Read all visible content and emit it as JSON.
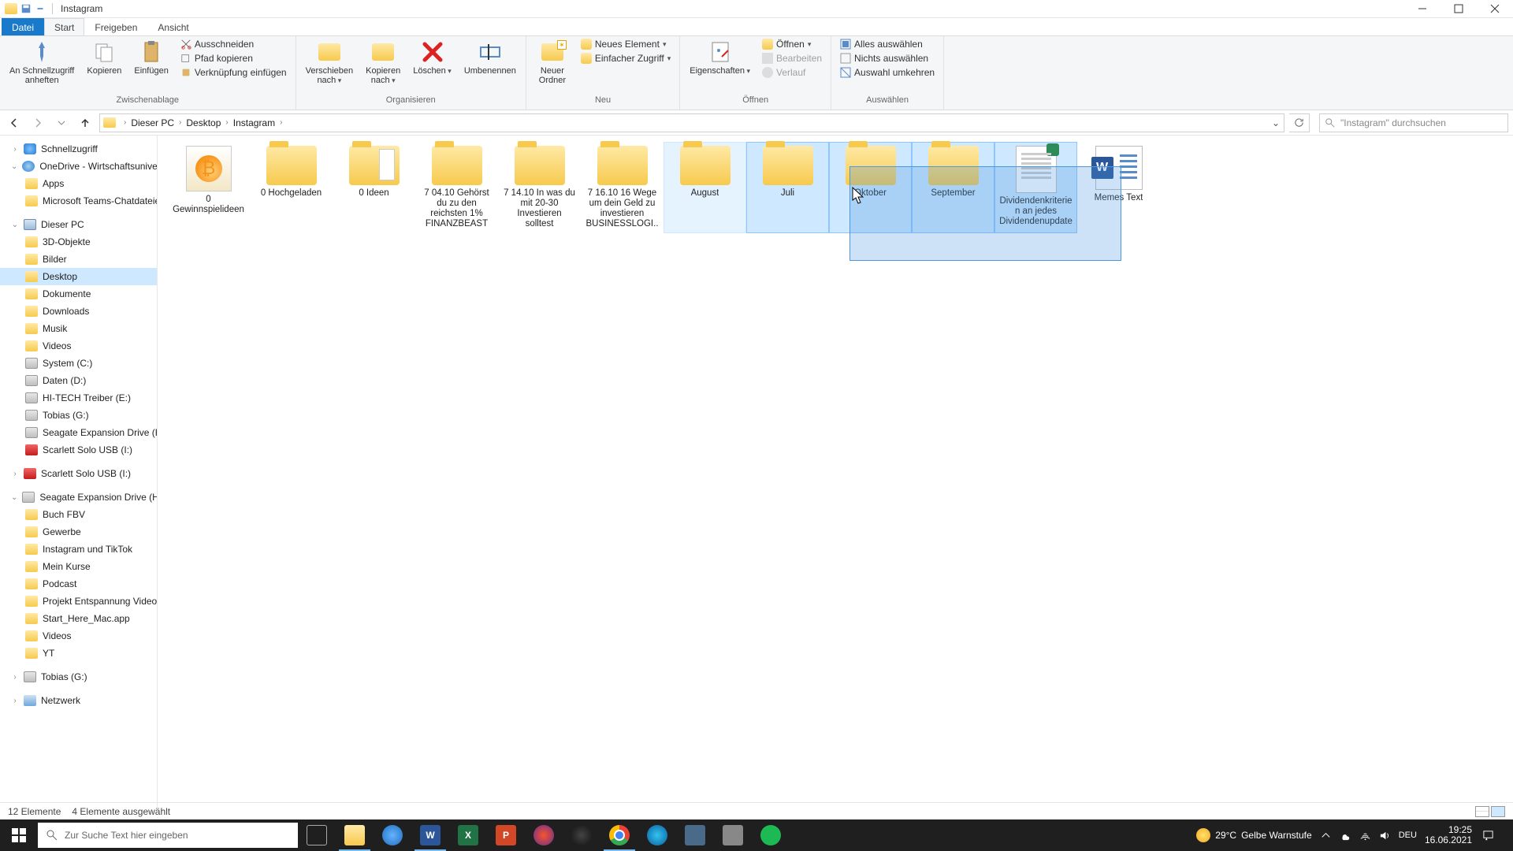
{
  "window": {
    "title": "Instagram"
  },
  "tabs": {
    "file": "Datei",
    "start": "Start",
    "share": "Freigeben",
    "view": "Ansicht"
  },
  "ribbon": {
    "clipboard": {
      "pin": "An Schnellzugriff\nanheften",
      "copy": "Kopieren",
      "paste": "Einfügen",
      "cut": "Ausschneiden",
      "copypath": "Pfad kopieren",
      "pastelnk": "Verknüpfung einfügen",
      "label": "Zwischenablage"
    },
    "organize": {
      "moveto": "Verschieben\nnach",
      "copyto": "Kopieren\nnach",
      "delete": "Löschen",
      "rename": "Umbenennen",
      "label": "Organisieren"
    },
    "new": {
      "newfolder": "Neuer\nOrdner",
      "newitem": "Neues Element",
      "easyaccess": "Einfacher Zugriff",
      "label": "Neu"
    },
    "open": {
      "properties": "Eigenschaften",
      "open": "Öffnen",
      "edit": "Bearbeiten",
      "history": "Verlauf",
      "label": "Öffnen"
    },
    "select": {
      "selectall": "Alles auswählen",
      "selectnone": "Nichts auswählen",
      "invert": "Auswahl umkehren",
      "label": "Auswählen"
    }
  },
  "breadcrumb": [
    "Dieser PC",
    "Desktop",
    "Instagram"
  ],
  "search_placeholder": "\"Instagram\" durchsuchen",
  "tree": [
    {
      "icon": "star",
      "label": "Schnellzugriff",
      "level": 1,
      "exp": "›"
    },
    {
      "icon": "onedrive",
      "label": "OneDrive - Wirtschaftsuniversität",
      "level": 1,
      "exp": "⌄"
    },
    {
      "icon": "folder",
      "label": "Apps",
      "level": 2
    },
    {
      "icon": "folder",
      "label": "Microsoft Teams-Chatdateien",
      "level": 2
    },
    {
      "icon": "pc",
      "label": "Dieser PC",
      "level": 1,
      "exp": "⌄"
    },
    {
      "icon": "folder",
      "label": "3D-Objekte",
      "level": 2
    },
    {
      "icon": "folder",
      "label": "Bilder",
      "level": 2
    },
    {
      "icon": "folder",
      "label": "Desktop",
      "level": 2,
      "sel": true
    },
    {
      "icon": "folder",
      "label": "Dokumente",
      "level": 2
    },
    {
      "icon": "folder",
      "label": "Downloads",
      "level": 2
    },
    {
      "icon": "folder",
      "label": "Musik",
      "level": 2
    },
    {
      "icon": "folder",
      "label": "Videos",
      "level": 2
    },
    {
      "icon": "drive",
      "label": "System (C:)",
      "level": 2
    },
    {
      "icon": "drive",
      "label": "Daten (D:)",
      "level": 2
    },
    {
      "icon": "drive",
      "label": "HI-TECH Treiber (E:)",
      "level": 2
    },
    {
      "icon": "drive",
      "label": "Tobias (G:)",
      "level": 2
    },
    {
      "icon": "drive",
      "label": "Seagate Expansion Drive (H:)",
      "level": 2
    },
    {
      "icon": "red",
      "label": "Scarlett Solo USB (I:)",
      "level": 2
    },
    {
      "icon": "red",
      "label": "Scarlett Solo USB (I:)",
      "level": 1,
      "exp": "›"
    },
    {
      "icon": "drive",
      "label": "Seagate Expansion Drive (H:)",
      "level": 1,
      "exp": "⌄"
    },
    {
      "icon": "folder",
      "label": "Buch FBV",
      "level": 2
    },
    {
      "icon": "folder",
      "label": "Gewerbe",
      "level": 2
    },
    {
      "icon": "folder",
      "label": "Instagram und TikTok",
      "level": 2
    },
    {
      "icon": "folder",
      "label": "Mein Kurse",
      "level": 2
    },
    {
      "icon": "folder",
      "label": "Podcast",
      "level": 2
    },
    {
      "icon": "folder",
      "label": "Projekt Entspannung Videos",
      "level": 2
    },
    {
      "icon": "folder",
      "label": "Start_Here_Mac.app",
      "level": 2
    },
    {
      "icon": "folder",
      "label": "Videos",
      "level": 2
    },
    {
      "icon": "folder",
      "label": "YT",
      "level": 2
    },
    {
      "icon": "drive",
      "label": "Tobias (G:)",
      "level": 1,
      "exp": "›"
    },
    {
      "icon": "net",
      "label": "Netzwerk",
      "level": 1,
      "exp": "›"
    }
  ],
  "items": [
    {
      "type": "bitcoin",
      "name": "0 Gewinnspielideen",
      "sel": false
    },
    {
      "type": "folder",
      "name": "0 Hochgeladen",
      "sel": false
    },
    {
      "type": "folderpaper",
      "name": "0 Ideen",
      "sel": false
    },
    {
      "type": "folder",
      "name": "7   04.10 Gehörst du zu den reichsten 1% FINANZBEAST",
      "sel": false
    },
    {
      "type": "folder",
      "name": "7   14.10 In was du mit 20-30 Investieren solltest",
      "sel": false
    },
    {
      "type": "folder",
      "name": "7   16.10 16 Wege um dein Geld zu investieren BUSINESSLOGI...",
      "sel": false
    },
    {
      "type": "folder",
      "name": "August",
      "sel": false,
      "hov": true
    },
    {
      "type": "folder",
      "name": "Juli",
      "sel": true
    },
    {
      "type": "folder",
      "name": "Oktober",
      "sel": true
    },
    {
      "type": "folder",
      "name": "September",
      "sel": true
    },
    {
      "type": "docgreen",
      "name": "Dividendenkriterien an jedes Dividendenupdate",
      "sel": true
    },
    {
      "type": "word",
      "name": "Memes Text",
      "sel": false
    }
  ],
  "status": {
    "count": "12 Elemente",
    "selected": "4 Elemente ausgewählt"
  },
  "taskbar": {
    "search_placeholder": "Zur Suche Text hier eingeben",
    "weather_temp": "29°C",
    "weather_text": "Gelbe Warnstufe",
    "lang": "DEU",
    "time": "19:25",
    "date": "16.06.2021"
  }
}
